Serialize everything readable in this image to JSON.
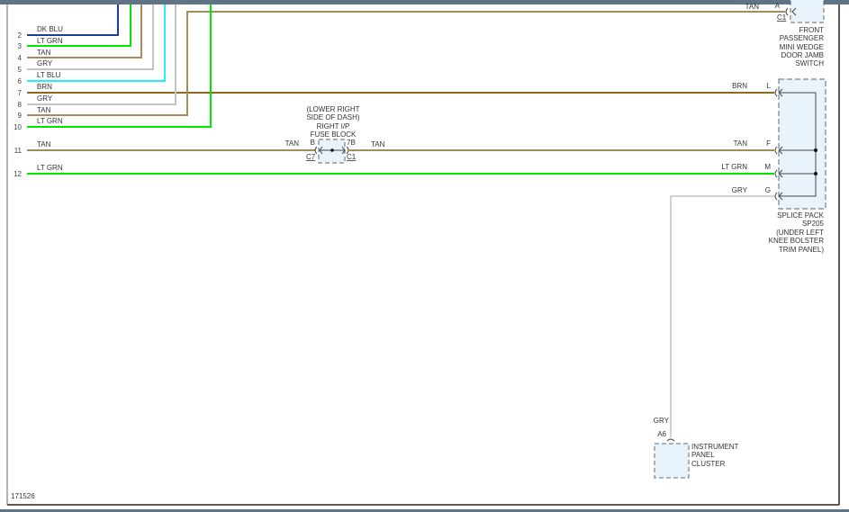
{
  "diagram_id": "171526",
  "colors": {
    "dk_blu": "#1f3c99",
    "lt_grn": "#00e600",
    "tan": "#a38b5a",
    "gry": "#c4c4c4",
    "lt_blu": "#22f0ff",
    "brn": "#8a6a1c",
    "box_fill": "#e8f3fb",
    "top_bar": "#5f7487"
  },
  "wires": [
    {
      "num": "2",
      "color": "DK BLU"
    },
    {
      "num": "3",
      "color": "LT GRN"
    },
    {
      "num": "4",
      "color": "TAN"
    },
    {
      "num": "5",
      "color": "GRY"
    },
    {
      "num": "6",
      "color": "LT BLU"
    },
    {
      "num": "7",
      "color": "BRN"
    },
    {
      "num": "8",
      "color": "GRY"
    },
    {
      "num": "9",
      "color": "TAN"
    },
    {
      "num": "10",
      "color": "LT GRN"
    },
    {
      "num": "11",
      "color": "TAN"
    },
    {
      "num": "12",
      "color": "LT GRN"
    }
  ],
  "door_switch": {
    "wire": "TAN",
    "pin": "A",
    "conn": "C1",
    "label": [
      "FRONT",
      "PASSENGER",
      "MINI WEDGE",
      "DOOR JAMB",
      "SWITCH"
    ]
  },
  "fuse_block": {
    "label": [
      "(LOWER RIGHT",
      "SIDE OF DASH)",
      "RIGHT I/P",
      "FUSE BLOCK"
    ],
    "left_wire": "TAN",
    "left_pin": "B",
    "left_conn": "C7",
    "right_pin": "7B",
    "right_conn": "C1",
    "right_wire": "TAN"
  },
  "splice_pack": {
    "pins": [
      {
        "wire": "BRN",
        "pin": "L"
      },
      {
        "wire": "TAN",
        "pin": "F"
      },
      {
        "wire": "LT GRN",
        "pin": "M"
      },
      {
        "wire": "GRY",
        "pin": "G"
      }
    ],
    "label": [
      "SPLICE PACK",
      "SP205",
      "(UNDER LEFT",
      "KNEE BOLSTER",
      "TRIM PANEL)"
    ]
  },
  "cluster": {
    "wire": "GRY",
    "pin": "A6",
    "label": [
      "INSTRUMENT",
      "PANEL",
      "CLUSTER"
    ]
  }
}
